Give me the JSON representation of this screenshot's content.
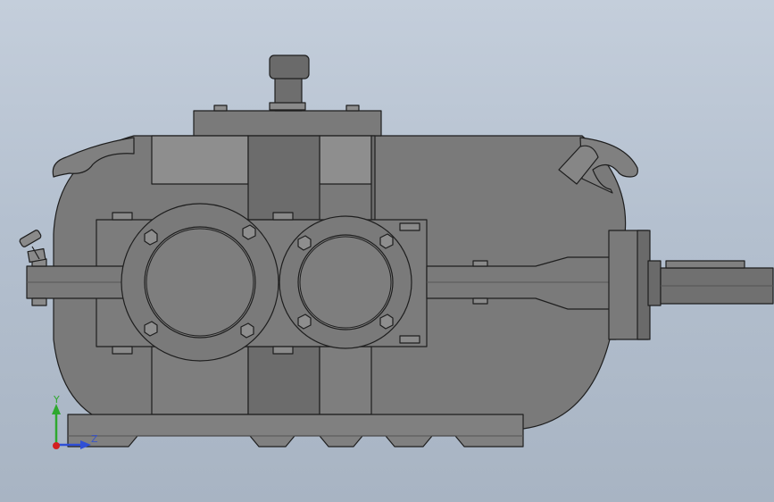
{
  "viewport": {
    "background_top": "#c4cedb",
    "background_bottom": "#a8b4c3"
  },
  "model": {
    "body_color": "#7a7a7a",
    "dark_color": "#5c5c5c",
    "light_color": "#8e8e8e",
    "edge_color": "#1e1e1e"
  },
  "triad": {
    "y_label": "Y",
    "z_label": "Z",
    "y_color": "#2ea82e",
    "z_color": "#2f4fd6",
    "origin_color": "#d42020"
  }
}
